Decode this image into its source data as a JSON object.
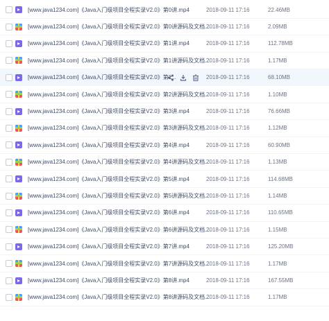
{
  "rows": [
    {
      "name": "[www.java1234.com]《Java入门级项目全程实录V2.0》第0讲.mp4",
      "date": "2018-09-11 17:16",
      "size": "22.46MB",
      "icon": "video-icon"
    },
    {
      "name": "[www.java1234.com]《Java入门级项目全程实录V2.0》第0讲源码及文档...",
      "date": "2018-09-11 17:16",
      "size": "2.09MB",
      "icon": "archive-icon"
    },
    {
      "name": "[www.java1234.com]《Java入门级项目全程实录V2.0》第1讲.mp4",
      "date": "2018-09-11 17:16",
      "size": "112.78MB",
      "icon": "video-icon"
    },
    {
      "name": "[www.java1234.com]《Java入门级项目全程实录V2.0》第1讲源码及文档...",
      "date": "2018-09-11 17:16",
      "size": "1.17MB",
      "icon": "archive-icon"
    },
    {
      "name": "[www.java1234.com]《Java入门级项目全程实录V2.0》第1...",
      "date": "2018-09-11 17:16",
      "size": "68.10MB",
      "icon": "video-icon",
      "hover": true
    },
    {
      "name": "[www.java1234.com]《Java入门级项目全程实录V2.0》第2讲源码及文档...",
      "date": "2018-09-11 17:16",
      "size": "1.10MB",
      "icon": "archive-icon"
    },
    {
      "name": "[www.java1234.com]《Java入门级项目全程实录V2.0》第3讲.mp4",
      "date": "2018-09-11 17:16",
      "size": "76.66MB",
      "icon": "video-icon"
    },
    {
      "name": "[www.java1234.com]《Java入门级项目全程实录V2.0》第3讲源码及文档...",
      "date": "2018-09-11 17:16",
      "size": "1.12MB",
      "icon": "archive-icon"
    },
    {
      "name": "[www.java1234.com]《Java入门级项目全程实录V2.0》第4讲.mp4",
      "date": "2018-09-11 17:16",
      "size": "60.90MB",
      "icon": "video-icon"
    },
    {
      "name": "[www.java1234.com]《Java入门级项目全程实录V2.0》第4讲源码及文档...",
      "date": "2018-09-11 17:16",
      "size": "1.13MB",
      "icon": "archive-icon"
    },
    {
      "name": "[www.java1234.com]《Java入门级项目全程实录V2.0》第5讲.mp4",
      "date": "2018-09-11 17:16",
      "size": "114.68MB",
      "icon": "video-icon"
    },
    {
      "name": "[www.java1234.com]《Java入门级项目全程实录V2.0》第5讲源码及文档...",
      "date": "2018-09-11 17:16",
      "size": "1.14MB",
      "icon": "archive-icon"
    },
    {
      "name": "[www.java1234.com]《Java入门级项目全程实录V2.0》第6讲.mp4",
      "date": "2018-09-11 17:16",
      "size": "110.65MB",
      "icon": "video-icon"
    },
    {
      "name": "[www.java1234.com]《Java入门级项目全程实录V2.0》第6讲源码及文档...",
      "date": "2018-09-11 17:16",
      "size": "1.15MB",
      "icon": "archive-icon"
    },
    {
      "name": "[www.java1234.com]《Java入门级项目全程实录V2.0》第7讲.mp4",
      "date": "2018-09-11 17:16",
      "size": "125.20MB",
      "icon": "video-icon"
    },
    {
      "name": "[www.java1234.com]《Java入门级项目全程实录V2.0》第7讲源码及文档...",
      "date": "2018-09-11 17:16",
      "size": "1.17MB",
      "icon": "archive-icon"
    },
    {
      "name": "[www.java1234.com]《Java入门级项目全程实录V2.0》第8讲.mp4",
      "date": "2018-09-11 17:16",
      "size": "167.55MB",
      "icon": "video-icon"
    },
    {
      "name": "[www.java1234.com]《Java入门级项目全程实录V2.0》第8讲源码及文档...",
      "date": "2018-09-11 17:16",
      "size": "1.17MB",
      "icon": "archive-icon"
    }
  ],
  "hover_actions": [
    "share-icon",
    "download-icon",
    "delete-icon"
  ]
}
